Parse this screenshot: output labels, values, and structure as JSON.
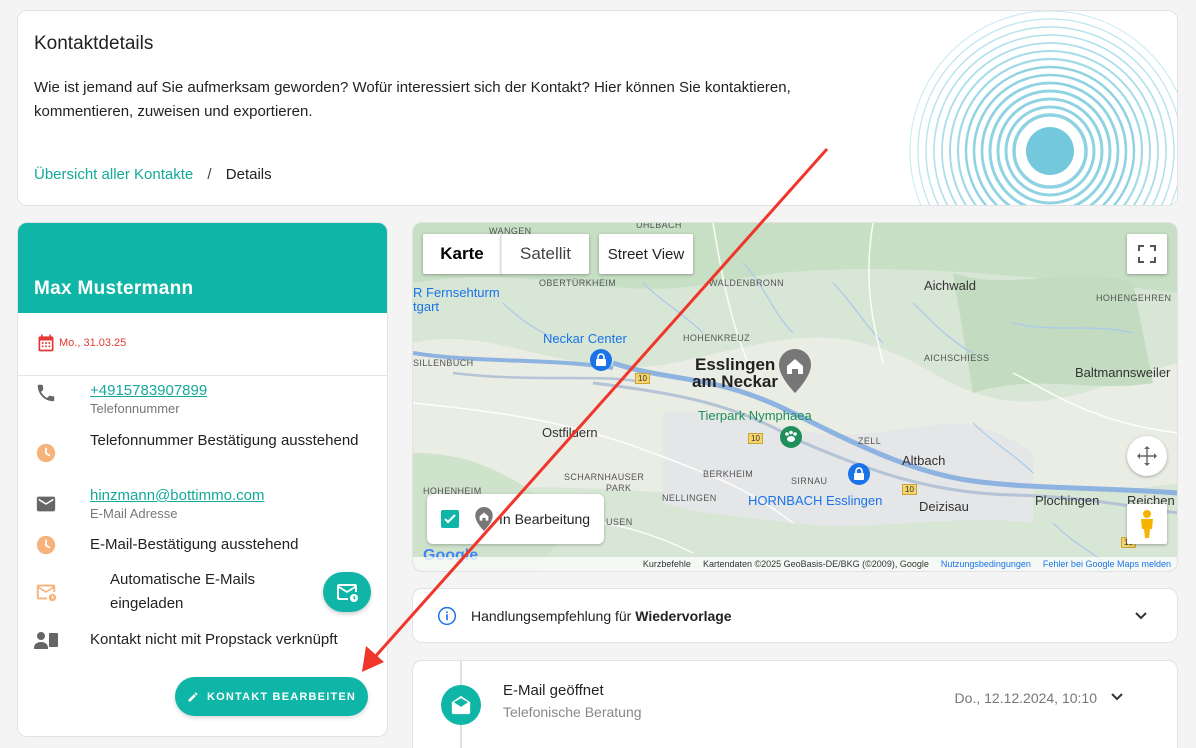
{
  "header": {
    "title": "Kontaktdetails",
    "description": "Wie ist jemand auf Sie aufmerksam geworden? Wofür interessiert sich der Kontakt? Hier können Sie kontaktieren, kommentieren, zuweisen und exportieren.",
    "breadcrumb": {
      "link": "Übersicht aller Kontakte",
      "separator": "/",
      "current": "Details"
    }
  },
  "contact": {
    "name": "Max Mustermann",
    "date": "Mo., 31.03.25",
    "phone": "+4915783907899",
    "phone_label": "Telefonnummer",
    "phone_status": "Telefonnummer Bestätigung ausstehend",
    "email": "hinzmann@bottimmo.com",
    "email_label": "E-Mail Adresse",
    "email_status": "E-Mail-Bestätigung ausstehend",
    "auto_emails": "Automatische E-Mails eingeladen",
    "propstack": "Kontakt nicht mit Propstack verknüpft",
    "edit_button": "KONTAKT BEARBEITEN",
    "accent_color": "#0fb5a6",
    "warning_color": "#f5b27a",
    "date_color": "#e53935"
  },
  "map": {
    "type_map": "Karte",
    "type_satellite": "Satellit",
    "street_view": "Street View",
    "legend_label": "In Bearbeitung",
    "labels": {
      "wangen": "WANGEN",
      "uhlbach": "UHLBACH",
      "fernsehturm1": "R Fernsehturm",
      "fernsehturm2": "tgart",
      "obertuerkheim": "OBERTÜRKHEIM",
      "waldenbronn": "WALDENBRONN",
      "aichwald": "Aichwald",
      "hohengehren": "HOHENGEHREN",
      "neckarcenter": "Neckar Center",
      "hohenkreuz": "HOHENKREUZ",
      "sillenbuch": "SILLENBUCH",
      "esslingen1": "Esslingen",
      "esslingen2": "am Neckar",
      "aichschiess": "AICHSCHIESS",
      "baltmannsweiler": "Baltmannsweiler",
      "tierpark": "Tierpark Nymphaea",
      "ostfildern": "Ostfildern",
      "zell": "ZELL",
      "altbach": "Altbach",
      "berkheim": "BERKHEIM",
      "scharnhauser1": "SCHARNHAUSER",
      "scharnhauser2": "PARK",
      "sirnau": "SIRNAU",
      "hohenheim": "HOHENHEIM",
      "nellingen": "NELLINGEN",
      "hornbach": "HORNBACH Esslingen",
      "deizisau": "Deizisau",
      "plochingen": "Plochingen",
      "reichen": "Reichen",
      "usen": "USEN",
      "road1": "10",
      "road2": "10",
      "road3": "10",
      "road4": "10"
    },
    "attribution": {
      "shortcuts": "Kurzbefehle",
      "data": "Kartendaten ©2025 GeoBasis-DE/BKG (©2009), Google",
      "terms": "Nutzungsbedingungen",
      "report": "Fehler bei Google Maps melden"
    },
    "google_logo": "Google"
  },
  "accordion": {
    "prefix": "Handlungsempfehlung für ",
    "bold": "Wiedervorlage"
  },
  "timeline": {
    "title": "E-Mail geöffnet",
    "subtitle": "Telefonische Beratung",
    "date": "Do., 12.12.2024, 10:10"
  }
}
